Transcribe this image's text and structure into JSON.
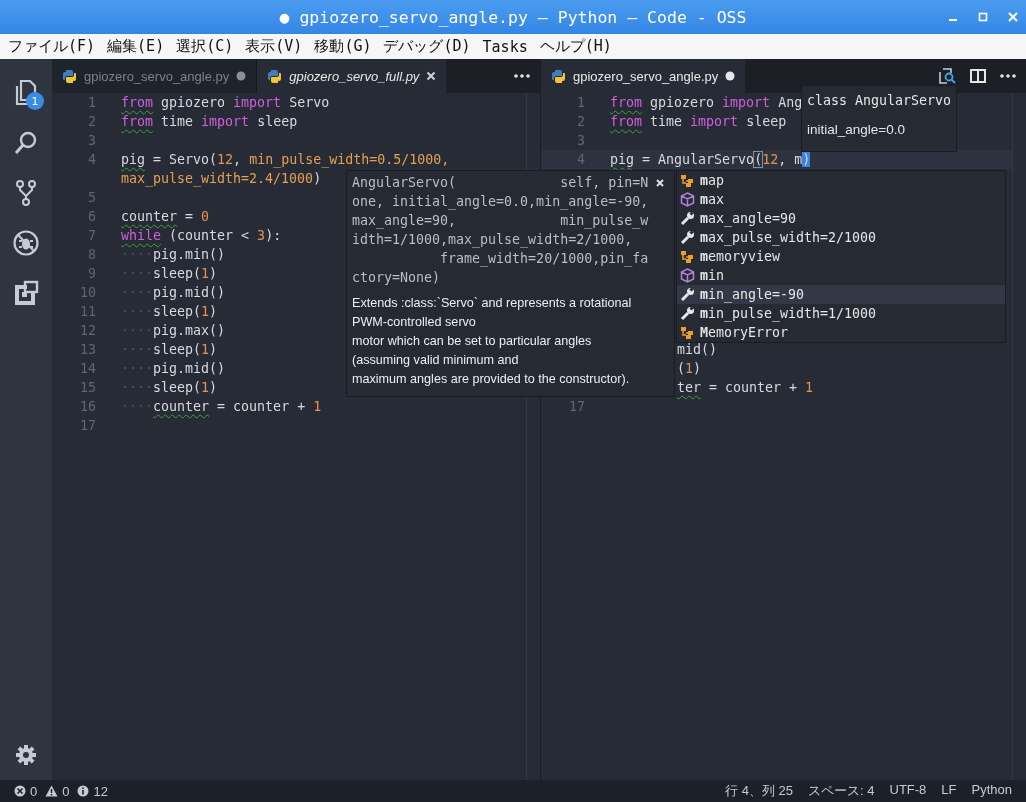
{
  "window": {
    "title": "● gpiozero_servo_angle.py — Python — Code - OSS"
  },
  "menu": [
    "ファイル(F)",
    "編集(E)",
    "選択(C)",
    "表示(V)",
    "移動(G)",
    "デバッグ(D)",
    "Tasks",
    "ヘルプ(H)"
  ],
  "activity_bar": [
    {
      "kind": "files",
      "badge": "1"
    },
    {
      "kind": "search"
    },
    {
      "kind": "scm"
    },
    {
      "kind": "debug"
    },
    {
      "kind": "extensions"
    }
  ],
  "editors": [
    {
      "tabs": [
        {
          "label": "gpiozero_servo_angle.py",
          "selected": false,
          "dirty": true,
          "preview": false
        },
        {
          "label": "gpiozero_servo_full.py",
          "selected": true,
          "dirty": false,
          "preview": true
        }
      ],
      "lines": [
        {
          "kind": "code",
          "number": "1",
          "tokens": [
            {
              "t": "from",
              "kind": "kw",
              "warn": true
            },
            {
              "t": " gpiozero ",
              "kind": "id"
            },
            {
              "t": "import",
              "kind": "kw"
            },
            {
              "t": " Servo",
              "kind": "id"
            }
          ]
        },
        {
          "kind": "code",
          "number": "2",
          "tokens": [
            {
              "t": "from",
              "kind": "kw",
              "warn": true
            },
            {
              "t": " time ",
              "kind": "id"
            },
            {
              "t": "import",
              "kind": "kw"
            },
            {
              "t": " sleep",
              "kind": "id"
            }
          ]
        },
        {
          "kind": "code",
          "number": "3"
        },
        {
          "kind": "code",
          "number": "4",
          "tokens": [
            {
              "t": "pig",
              "kind": "id",
              "warn": true
            },
            {
              "t": " = Servo(",
              "kind": "id"
            },
            {
              "t": "12",
              "kind": "num"
            },
            {
              "t": ", ",
              "kind": "id"
            },
            {
              "t": "min_pulse_width=0.5/1000,",
              "kind": "arg"
            }
          ]
        },
        {
          "kind": "wrap",
          "tokens": [
            {
              "t": "max_pulse_width=2.4/1000",
              "kind": "arg"
            },
            {
              "t": ")",
              "kind": "id"
            }
          ]
        },
        {
          "kind": "code",
          "number": "5"
        },
        {
          "kind": "code",
          "number": "6",
          "tokens": [
            {
              "t": "counter",
              "kind": "id",
              "warn": true
            },
            {
              "t": " = ",
              "kind": "id"
            },
            {
              "t": "0",
              "kind": "num"
            }
          ]
        },
        {
          "kind": "code",
          "number": "7",
          "tokens": [
            {
              "t": "while",
              "kind": "kw",
              "warn": true
            },
            {
              "t": " (counter < ",
              "kind": "id"
            },
            {
              "t": "3",
              "kind": "num"
            },
            {
              "t": "):",
              "kind": "id"
            }
          ]
        },
        {
          "kind": "code",
          "number": "8",
          "tokens": [
            {
              "t": "····",
              "kind": "ws"
            },
            {
              "t": "pig.min()",
              "kind": "id"
            }
          ]
        },
        {
          "kind": "code",
          "number": "9",
          "tokens": [
            {
              "t": "····",
              "kind": "ws"
            },
            {
              "t": "sleep(",
              "kind": "id"
            },
            {
              "t": "1",
              "kind": "num"
            },
            {
              "t": ")",
              "kind": "id"
            }
          ]
        },
        {
          "kind": "code",
          "number": "10",
          "tokens": [
            {
              "t": "····",
              "kind": "ws"
            },
            {
              "t": "pig.mid()",
              "kind": "id"
            }
          ]
        },
        {
          "kind": "code",
          "number": "11",
          "tokens": [
            {
              "t": "····",
              "kind": "ws"
            },
            {
              "t": "sleep(",
              "kind": "id"
            },
            {
              "t": "1",
              "kind": "num"
            },
            {
              "t": ")",
              "kind": "id"
            }
          ]
        },
        {
          "kind": "code",
          "number": "12",
          "tokens": [
            {
              "t": "····",
              "kind": "ws"
            },
            {
              "t": "pig.max()",
              "kind": "id"
            }
          ]
        },
        {
          "kind": "code",
          "number": "13",
          "tokens": [
            {
              "t": "····",
              "kind": "ws"
            },
            {
              "t": "sleep(",
              "kind": "id"
            },
            {
              "t": "1",
              "kind": "num"
            },
            {
              "t": ")",
              "kind": "id"
            }
          ]
        },
        {
          "kind": "code",
          "number": "14",
          "tokens": [
            {
              "t": "····",
              "kind": "ws"
            },
            {
              "t": "pig.mid()",
              "kind": "id"
            }
          ]
        },
        {
          "kind": "code",
          "number": "15",
          "tokens": [
            {
              "t": "····",
              "kind": "ws"
            },
            {
              "t": "sleep(",
              "kind": "id"
            },
            {
              "t": "1",
              "kind": "num"
            },
            {
              "t": ")",
              "kind": "id"
            }
          ]
        },
        {
          "kind": "code",
          "number": "16",
          "tokens": [
            {
              "t": "····",
              "kind": "ws"
            },
            {
              "t": "counter",
              "kind": "id",
              "warn": true
            },
            {
              "t": " = counter + ",
              "kind": "id"
            },
            {
              "t": "1",
              "kind": "num"
            }
          ]
        },
        {
          "kind": "code",
          "number": "17"
        }
      ]
    },
    {
      "tabs": [
        {
          "label": "gpiozero_servo_angle.py",
          "selected": true,
          "dirty": true,
          "preview": false
        }
      ],
      "lines": [
        {
          "kind": "code",
          "number": "1",
          "tokens": [
            {
              "t": "from",
              "kind": "kw",
              "warn": true
            },
            {
              "t": " gpiozero ",
              "kind": "id"
            },
            {
              "t": "import",
              "kind": "kw"
            },
            {
              "t": " Ang",
              "kind": "id"
            }
          ]
        },
        {
          "kind": "code",
          "number": "2",
          "tokens": [
            {
              "t": "from",
              "kind": "kw",
              "warn": true
            },
            {
              "t": " time ",
              "kind": "id"
            },
            {
              "t": "import",
              "kind": "kw"
            },
            {
              "t": " sleep",
              "kind": "id"
            }
          ]
        },
        {
          "kind": "code",
          "number": "3"
        },
        {
          "kind": "code",
          "number": "4",
          "current": true,
          "tokens": [
            {
              "t": "pig",
              "kind": "id",
              "warn": true
            },
            {
              "t": " = AngularServo",
              "kind": "id"
            },
            {
              "t": "(",
              "kind": "bracket"
            },
            {
              "t": "12",
              "kind": "num"
            },
            {
              "t": ", m",
              "kind": "id"
            },
            {
              "t": ")",
              "kind": "sel"
            }
          ]
        },
        {
          "kind": "covered"
        },
        {
          "kind": "covered"
        },
        {
          "kind": "covered"
        },
        {
          "kind": "covered"
        },
        {
          "kind": "covered"
        },
        {
          "kind": "covered"
        },
        {
          "kind": "covered"
        },
        {
          "kind": "covered"
        },
        {
          "kind": "covered"
        },
        {
          "kind": "clipped",
          "tokens": [
            {
              "t": "mid()",
              "kind": "id"
            }
          ]
        },
        {
          "kind": "clipped",
          "tokens": [
            {
              "t": "(",
              "kind": "id"
            },
            {
              "t": "1",
              "kind": "num"
            },
            {
              "t": ")",
              "kind": "id"
            }
          ]
        },
        {
          "kind": "clipped",
          "tokens": [
            {
              "t": "ter",
              "kind": "id",
              "warn": true
            },
            {
              "t": " = counter + ",
              "kind": "id"
            },
            {
              "t": "1",
              "kind": "num"
            }
          ]
        },
        {
          "kind": "code",
          "number": "17"
        }
      ]
    }
  ],
  "signature_help": {
    "signature": [
      "AngularServo(             self, pin=N",
      "one, initial_angle=0.0,min_angle=-90,",
      "max_angle=90,             min_pulse_w",
      "idth=1/1000,max_pulse_width=2/1000,",
      "           frame_width=20/1000,pin_fa",
      "ctory=None)"
    ],
    "doc": [
      "Extends :class:`Servo` and represents a rotational",
      "PWM-controlled servo",
      "motor which can be set to particular angles",
      "(assuming valid minimum and",
      "maximum angles are provided to the constructor)."
    ]
  },
  "hover": {
    "signature": "class AngularServo",
    "doc": "initial_angle=0.0"
  },
  "suggestions": [
    {
      "label": "**m**ap",
      "kind": "function",
      "selected": false
    },
    {
      "label": "**m**ax",
      "kind": "method",
      "selected": false
    },
    {
      "label": "**m**ax_angle=90",
      "kind": "property",
      "selected": false
    },
    {
      "label": "**m**ax_pulse_width=2/1000",
      "kind": "property",
      "selected": false
    },
    {
      "label": "**m**emoryview",
      "kind": "function",
      "selected": false
    },
    {
      "label": "**m**in",
      "kind": "method",
      "selected": false
    },
    {
      "label": "**m**in_angle=-90",
      "kind": "property",
      "selected": true
    },
    {
      "label": "**m**in_pulse_width=1/1000",
      "kind": "property",
      "selected": false
    },
    {
      "label": "**M**emoryError",
      "kind": "function",
      "selected": false
    }
  ],
  "status_bar": {
    "problems": [
      {
        "kind": "error",
        "count": "0"
      },
      {
        "kind": "warning",
        "count": "0"
      },
      {
        "kind": "info",
        "count": "12"
      }
    ],
    "items": [
      "行 4、列 25",
      "スペース: 4",
      "UTF-8",
      "LF",
      "Python"
    ]
  }
}
